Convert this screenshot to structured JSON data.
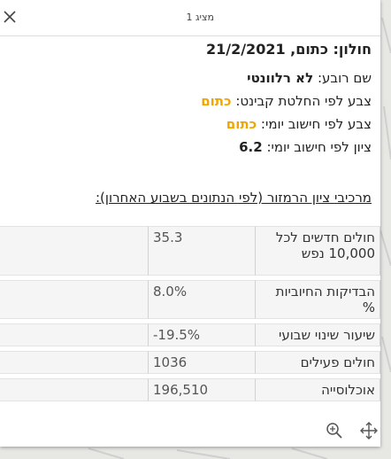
{
  "header": {
    "pager": "מציג 1"
  },
  "title": {
    "prefix": "חולון:",
    "status": "כתום,",
    "date": "21/2/2021"
  },
  "details": {
    "neighborhood_label": "שם רובע:",
    "neighborhood_value": "לא רלוונטי",
    "cabinet_color_label": "צבע לפי החלטת קבינט:",
    "cabinet_color_value": "כתום",
    "daily_color_label": "צבע לפי חישוב יומי:",
    "daily_color_value": "כתום",
    "daily_score_label": "ציון לפי חישוב יומי:",
    "daily_score_value": "6.2"
  },
  "components_link": "מרכיבי ציון הרמזור (לפי הנתונים בשבוע האחרון):",
  "metrics": [
    {
      "label": "חולים חדשים לכל 10,000 נפש",
      "value": "35.3"
    },
    {
      "label": "הבדיקות החיוביות %",
      "value": "8.0%"
    },
    {
      "label": "שיעור שינוי שבועי",
      "value": "-19.5%"
    },
    {
      "label": "חולים פעילים",
      "value": "1036"
    },
    {
      "label": "אוכלוסייה",
      "value": "196,510"
    }
  ],
  "icons": {
    "close": "close-icon",
    "zoom": "zoom-in-icon",
    "pan": "move-icon"
  },
  "colors": {
    "orange": "#f0a500"
  }
}
